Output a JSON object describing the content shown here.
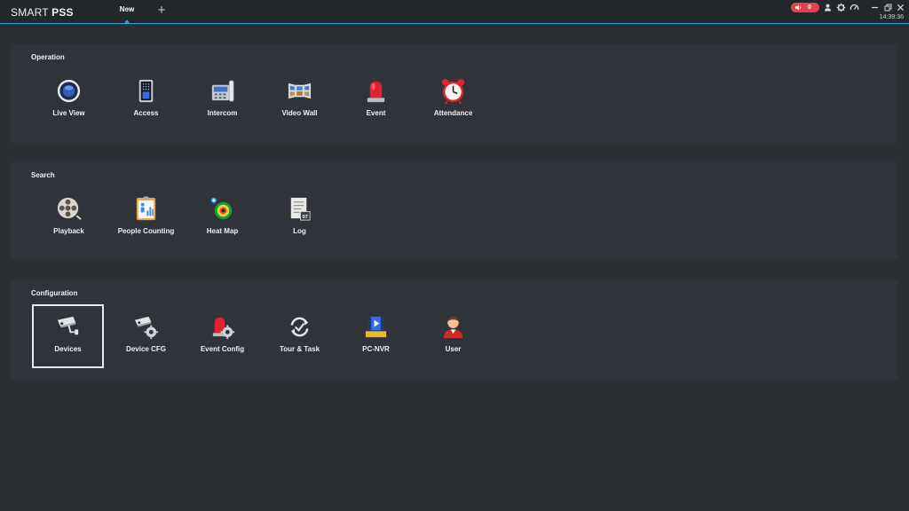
{
  "app": {
    "brand_part1": "SMART ",
    "brand_part2": "PSS"
  },
  "tabs": [
    {
      "label": "New",
      "active": true
    }
  ],
  "add_tab_label": "+",
  "status": {
    "alarm_count": "0",
    "clock": "14:39:36"
  },
  "colors": {
    "accent": "#1fa3d9",
    "alarm": "#e2424b",
    "background": "#2b2e33",
    "panel": "#30343a"
  },
  "sections": [
    {
      "title": "Operation",
      "items": [
        {
          "label": "Live View",
          "icon": "live-view-icon"
        },
        {
          "label": "Access",
          "icon": "access-icon"
        },
        {
          "label": "Intercom",
          "icon": "intercom-icon"
        },
        {
          "label": "Video Wall",
          "icon": "video-wall-icon"
        },
        {
          "label": "Event",
          "icon": "event-icon"
        },
        {
          "label": "Attendance",
          "icon": "alarm-clock-icon"
        }
      ]
    },
    {
      "title": "Search",
      "items": [
        {
          "label": "Playback",
          "icon": "film-reel-icon"
        },
        {
          "label": "People Counting",
          "icon": "people-counting-icon"
        },
        {
          "label": "Heat Map",
          "icon": "heat-map-icon"
        },
        {
          "label": "Log",
          "icon": "log-icon",
          "badge": "07"
        }
      ]
    },
    {
      "title": "Configuration",
      "items": [
        {
          "label": "Devices",
          "icon": "camera-icon",
          "selected": true
        },
        {
          "label": "Device CFG",
          "icon": "camera-gear-icon"
        },
        {
          "label": "Event Config",
          "icon": "event-gear-icon"
        },
        {
          "label": "Tour & Task",
          "icon": "refresh-check-icon"
        },
        {
          "label": "PC-NVR",
          "icon": "pc-nvr-icon"
        },
        {
          "label": "User",
          "icon": "user-icon"
        }
      ]
    }
  ]
}
